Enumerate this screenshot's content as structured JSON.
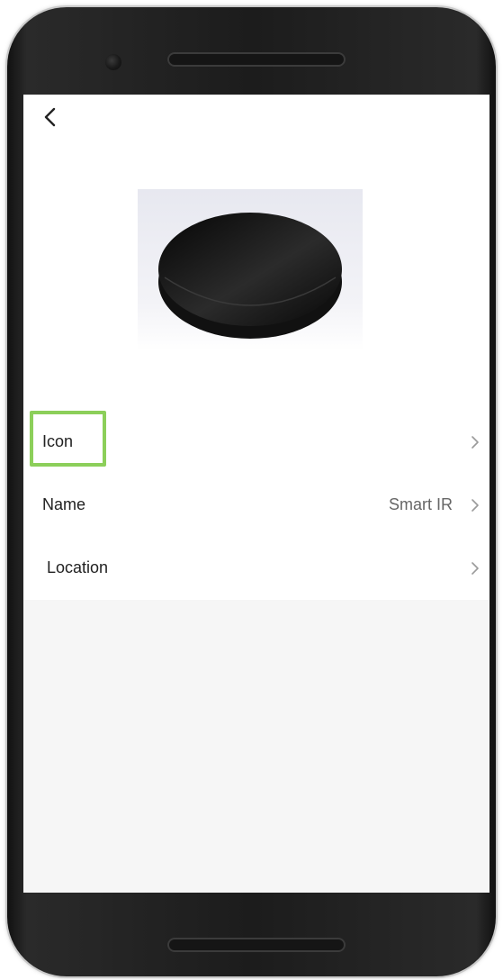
{
  "header": {
    "back_icon": "chevron-left-icon"
  },
  "device": {
    "image_icon": "round-black-smart-ir-device"
  },
  "settings": {
    "rows": [
      {
        "label": "Icon",
        "value": "",
        "chevron_icon": "chevron-right-icon"
      },
      {
        "label": "Name",
        "value": "Smart IR",
        "chevron_icon": "chevron-right-icon"
      },
      {
        "label": "Location",
        "value": "",
        "chevron_icon": "chevron-right-icon"
      }
    ]
  },
  "colors": {
    "highlight": "#8ccf5a",
    "panel_background": "#ffffff",
    "page_background": "#f6f6f6",
    "phone_body": "#1c1c1c"
  }
}
